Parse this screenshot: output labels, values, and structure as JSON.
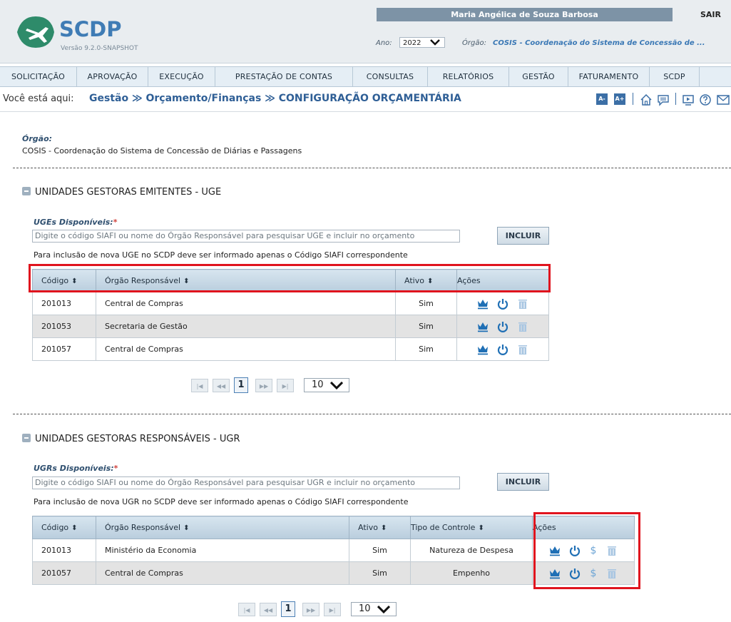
{
  "header": {
    "brand": "SCDP",
    "version": "Versão 9.2.0-SNAPSHOT",
    "user": "Maria Angélica de Souza Barbosa",
    "logout": "SAIR",
    "ano_label": "Ano:",
    "ano_value": "2022",
    "orgao_label": "Órgão:",
    "orgao_value": "COSIS - Coordenação do Sistema de Concessão de ..."
  },
  "nav": [
    "SOLICITAÇÃO",
    "APROVAÇÃO",
    "EXECUÇÃO",
    "PRESTAÇÃO DE CONTAS",
    "CONSULTAS",
    "RELATÓRIOS",
    "GESTÃO",
    "FATURAMENTO",
    "SCDP"
  ],
  "breadcrumb": {
    "label": "Você está aqui:",
    "path": "Gestão ≫ Orçamento/Finanças ≫ CONFIGURAÇÃO ORÇAMENTÁRIA",
    "font_minus": "A-",
    "font_plus": "A+"
  },
  "orgao": {
    "label": "Órgão:",
    "value": "COSIS - Coordenação do Sistema de Concessão de Diárias e Passagens"
  },
  "uge": {
    "section_title": "UNIDADES GESTORAS EMITENTES - UGE",
    "field_label": "UGEs Disponíveis:",
    "required": "*",
    "placeholder": "Digite o código SIAFI ou nome do Órgão Responsável para pesquisar UGE e incluir no orçamento",
    "include_button": "INCLUIR",
    "hint": "Para inclusão de nova UGE no SCDP deve ser informado apenas o Código SIAFI correspondente",
    "columns": {
      "codigo": "Código",
      "orgao": "Órgão Responsável",
      "ativo": "Ativo",
      "acoes": "Ações"
    },
    "rows": [
      {
        "codigo": "201013",
        "orgao": "Central de Compras",
        "ativo": "Sim"
      },
      {
        "codigo": "201053",
        "orgao": "Secretaria de Gestão",
        "ativo": "Sim"
      },
      {
        "codigo": "201057",
        "orgao": "Central de Compras",
        "ativo": "Sim"
      }
    ],
    "page": "1",
    "page_size": "10"
  },
  "ugr": {
    "section_title": "UNIDADES GESTORAS RESPONSÁVEIS - UGR",
    "field_label": "UGRs Disponíveis:",
    "required": "*",
    "placeholder": "Digite o código SIAFI ou nome do Órgão Responsável para pesquisar UGR e incluir no orçamento",
    "include_button": "INCLUIR",
    "hint": "Para inclusão de nova UGR no SCDP deve ser informado apenas o Código SIAFI correspondente",
    "columns": {
      "codigo": "Código",
      "orgao": "Órgão Responsável",
      "ativo": "Ativo",
      "tipo": "Tipo de Controle",
      "acoes": "Ações"
    },
    "rows": [
      {
        "codigo": "201013",
        "orgao": "Ministério da Economia",
        "ativo": "Sim",
        "tipo": "Natureza de Despesa"
      },
      {
        "codigo": "201057",
        "orgao": "Central de Compras",
        "ativo": "Sim",
        "tipo": "Empenho"
      }
    ],
    "page": "1",
    "page_size": "10"
  },
  "icons": {
    "crown": "crown-icon",
    "power": "power-icon",
    "trash": "trash-icon",
    "dollar": "dollar-icon",
    "dollar_glyph": "$"
  },
  "colors": {
    "link_blue": "#2f5f96",
    "icon_blue": "#1f6fb5",
    "highlight_red": "#e0141e"
  }
}
